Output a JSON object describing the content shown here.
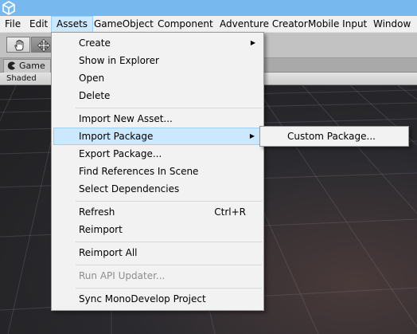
{
  "menubar": {
    "items": [
      "File",
      "Edit",
      "Assets",
      "GameObject",
      "Component",
      "Adventure Creator",
      "Mobile Input",
      "Window"
    ],
    "active_index": 2
  },
  "toolbar": {
    "tools": [
      "hand-tool",
      "move-tool"
    ]
  },
  "game_tab": {
    "label": "Game"
  },
  "scene_toolbar": {
    "shading_mode": "Shaded"
  },
  "assets_menu": {
    "create": "Create",
    "show_in_explorer": "Show in Explorer",
    "open": "Open",
    "delete": "Delete",
    "import_new_asset": "Import New Asset...",
    "import_package": "Import Package",
    "export_package": "Export Package...",
    "find_references": "Find References In Scene",
    "select_dependencies": "Select Dependencies",
    "refresh": "Refresh",
    "refresh_shortcut": "Ctrl+R",
    "reimport": "Reimport",
    "reimport_all": "Reimport All",
    "run_api_updater": "Run API Updater...",
    "sync_monodevelop": "Sync MonoDevelop Project"
  },
  "import_package_submenu": {
    "custom_package": "Custom Package..."
  },
  "colors": {
    "titlebar": "#77b9ee",
    "menu_highlight": "#cce8ff",
    "menu_highlight_border": "#99d1ff",
    "disabled_text": "#8d8d8d"
  }
}
